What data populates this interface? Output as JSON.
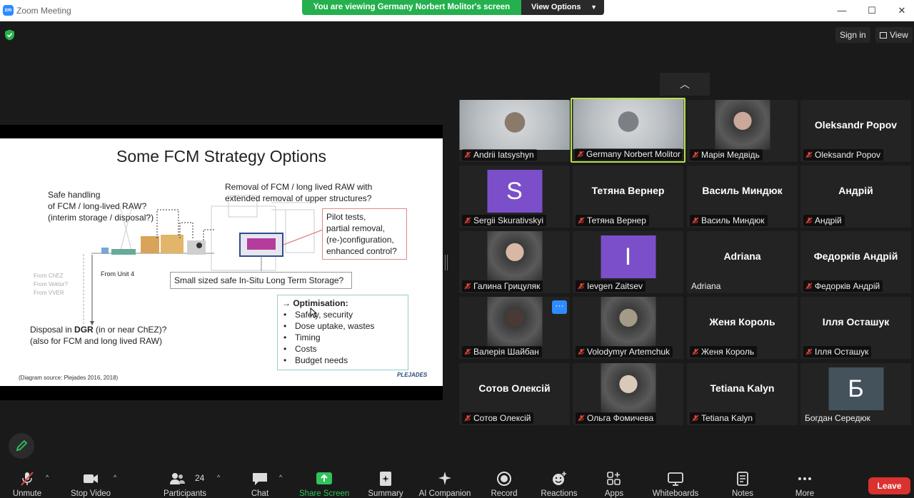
{
  "window": {
    "title": "Zoom Meeting",
    "logo": "zm"
  },
  "banner": {
    "message": "You are viewing Germany Norbert Molitor's screen",
    "options_label": "View Options"
  },
  "topbar": {
    "sign_in": "Sign in",
    "view": "View"
  },
  "slide": {
    "title": "Some FCM Strategy Options",
    "safe_handling": [
      "Safe handling",
      "of FCM / long-lived RAW?",
      "(interim storage / disposal?)"
    ],
    "removal": [
      "Removal of FCM / long lived RAW with",
      "extended removal of upper structures?"
    ],
    "pilot": [
      "Pilot tests,",
      "partial removal,",
      "(re-)configuration,",
      "enhanced control?"
    ],
    "from_unit": "From Unit 4",
    "sources": [
      "From ChEZ",
      "From Vektor?",
      "From VVER"
    ],
    "storage": "Small sized safe In-Situ Long Term Storage?",
    "disposal_prefix": "Disposal in ",
    "disposal_bold": "DGR",
    "disposal_suffix": " (in or near ChEZ)?",
    "disposal_line2": "(also for FCM and long lived RAW)",
    "optimisation_title": "→ Optimisation:",
    "optimisation_items": [
      "Safety, security",
      "Dose uptake, wastes",
      "Timing",
      "Costs",
      "Budget needs"
    ],
    "bullet": "•",
    "source": "(Diagram source: Plejades 2016, 2018)",
    "logo": "PLEJADES"
  },
  "gallery": {
    "up_arrow": "︿",
    "participants": [
      {
        "name": "Andrii Iatsyshyn",
        "type": "photo"
      },
      {
        "name": "Germany Norbert Molitor",
        "type": "photo",
        "active": true
      },
      {
        "name": "Марія Медвідь",
        "type": "photo"
      },
      {
        "name": "Oleksandr Popov",
        "type": "text",
        "big": "Oleksandr Popov"
      },
      {
        "name": "Sergii Skurativskyi",
        "type": "avatar",
        "letter": "S",
        "color": "#7b4fc9"
      },
      {
        "name": "Тетяна Вернер",
        "type": "text",
        "big": "Тетяна Вернер"
      },
      {
        "name": "Василь Миндюк",
        "type": "text",
        "big": "Василь Миндюк"
      },
      {
        "name": "Андрій",
        "type": "text",
        "big": "Андрій"
      },
      {
        "name": "Галина Грицуляк",
        "type": "photo"
      },
      {
        "name": "Ievgen Zaitsev",
        "type": "avatar",
        "letter": "I",
        "color": "#7b4fc9"
      },
      {
        "name": "Adriana",
        "type": "text",
        "big": "Adriana",
        "nomic": true
      },
      {
        "name": "Федорків Андрій",
        "type": "text",
        "big": "Федорків Андрій"
      },
      {
        "name": "Валерія Шайбан",
        "type": "photo"
      },
      {
        "name": "Volodymyr Artemchuk",
        "type": "photo"
      },
      {
        "name": "Женя Король",
        "type": "text",
        "big": "Женя Король"
      },
      {
        "name": "Ілля Осташук",
        "type": "text",
        "big": "Ілля Осташук"
      },
      {
        "name": "Сотов Олексій",
        "type": "text",
        "big": "Сотов Олексій"
      },
      {
        "name": "Ольга Фомичева",
        "type": "photo"
      },
      {
        "name": "Tetiana Kalyn",
        "type": "text",
        "big": "Tetiana Kalyn"
      },
      {
        "name": "Богдан Середюк",
        "type": "avatar",
        "letter": "Б",
        "color": "#44525c",
        "nomic": true
      }
    ],
    "more_dots": "···"
  },
  "toolbar": {
    "unmute": "Unmute",
    "stop_video": "Stop Video",
    "participants": "Participants",
    "participants_count": "24",
    "chat": "Chat",
    "share_screen": "Share Screen",
    "summary": "Summary",
    "ai_companion": "AI Companion",
    "record": "Record",
    "reactions": "Reactions",
    "apps": "Apps",
    "whiteboards": "Whiteboards",
    "notes": "Notes",
    "more": "More",
    "leave": "Leave",
    "caret": "^"
  },
  "colors": {
    "share_green": "#23b04d",
    "leave_red": "#d9322f",
    "active_border": "#b5e24a",
    "accent_blue": "#2d8cff"
  }
}
